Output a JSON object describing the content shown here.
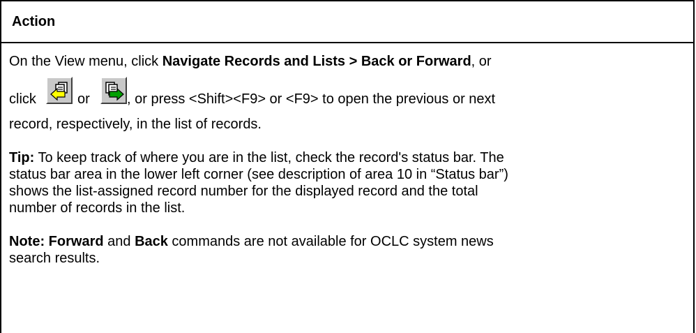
{
  "header": {
    "title": "Action"
  },
  "step": {
    "line1_prefix": "On the View menu, click ",
    "line1_bold": "Navigate Records and Lists > Back or Forward",
    "line1_suffix": ", or",
    "click_word": "click",
    "or_word": "or",
    "line2_suffix": ", or press <Shift><F9> or <F9> to open the previous or next",
    "line3": "record, respectively, in the list of records."
  },
  "icons": {
    "back": "back-record-icon",
    "forward": "forward-record-icon"
  },
  "tip": {
    "label": "Tip:",
    "line1": " To keep track of where you are in the list, check the record's status bar. The",
    "line2": "status bar area in the lower left corner (see description of area 10 in “Status bar”)",
    "line3": "shows the list-assigned record number for the displayed record and the total",
    "line4": "number of records in the list."
  },
  "note": {
    "label": "Note:",
    "forward_word": "Forward",
    "and_word": " and ",
    "back_word": "Back",
    "line1_rest": " commands are not available for OCLC system news",
    "line2": "search results."
  },
  "colors": {
    "icon_yellow": "#ffff00",
    "icon_green": "#00a000",
    "button_face": "#c8c8c8"
  }
}
